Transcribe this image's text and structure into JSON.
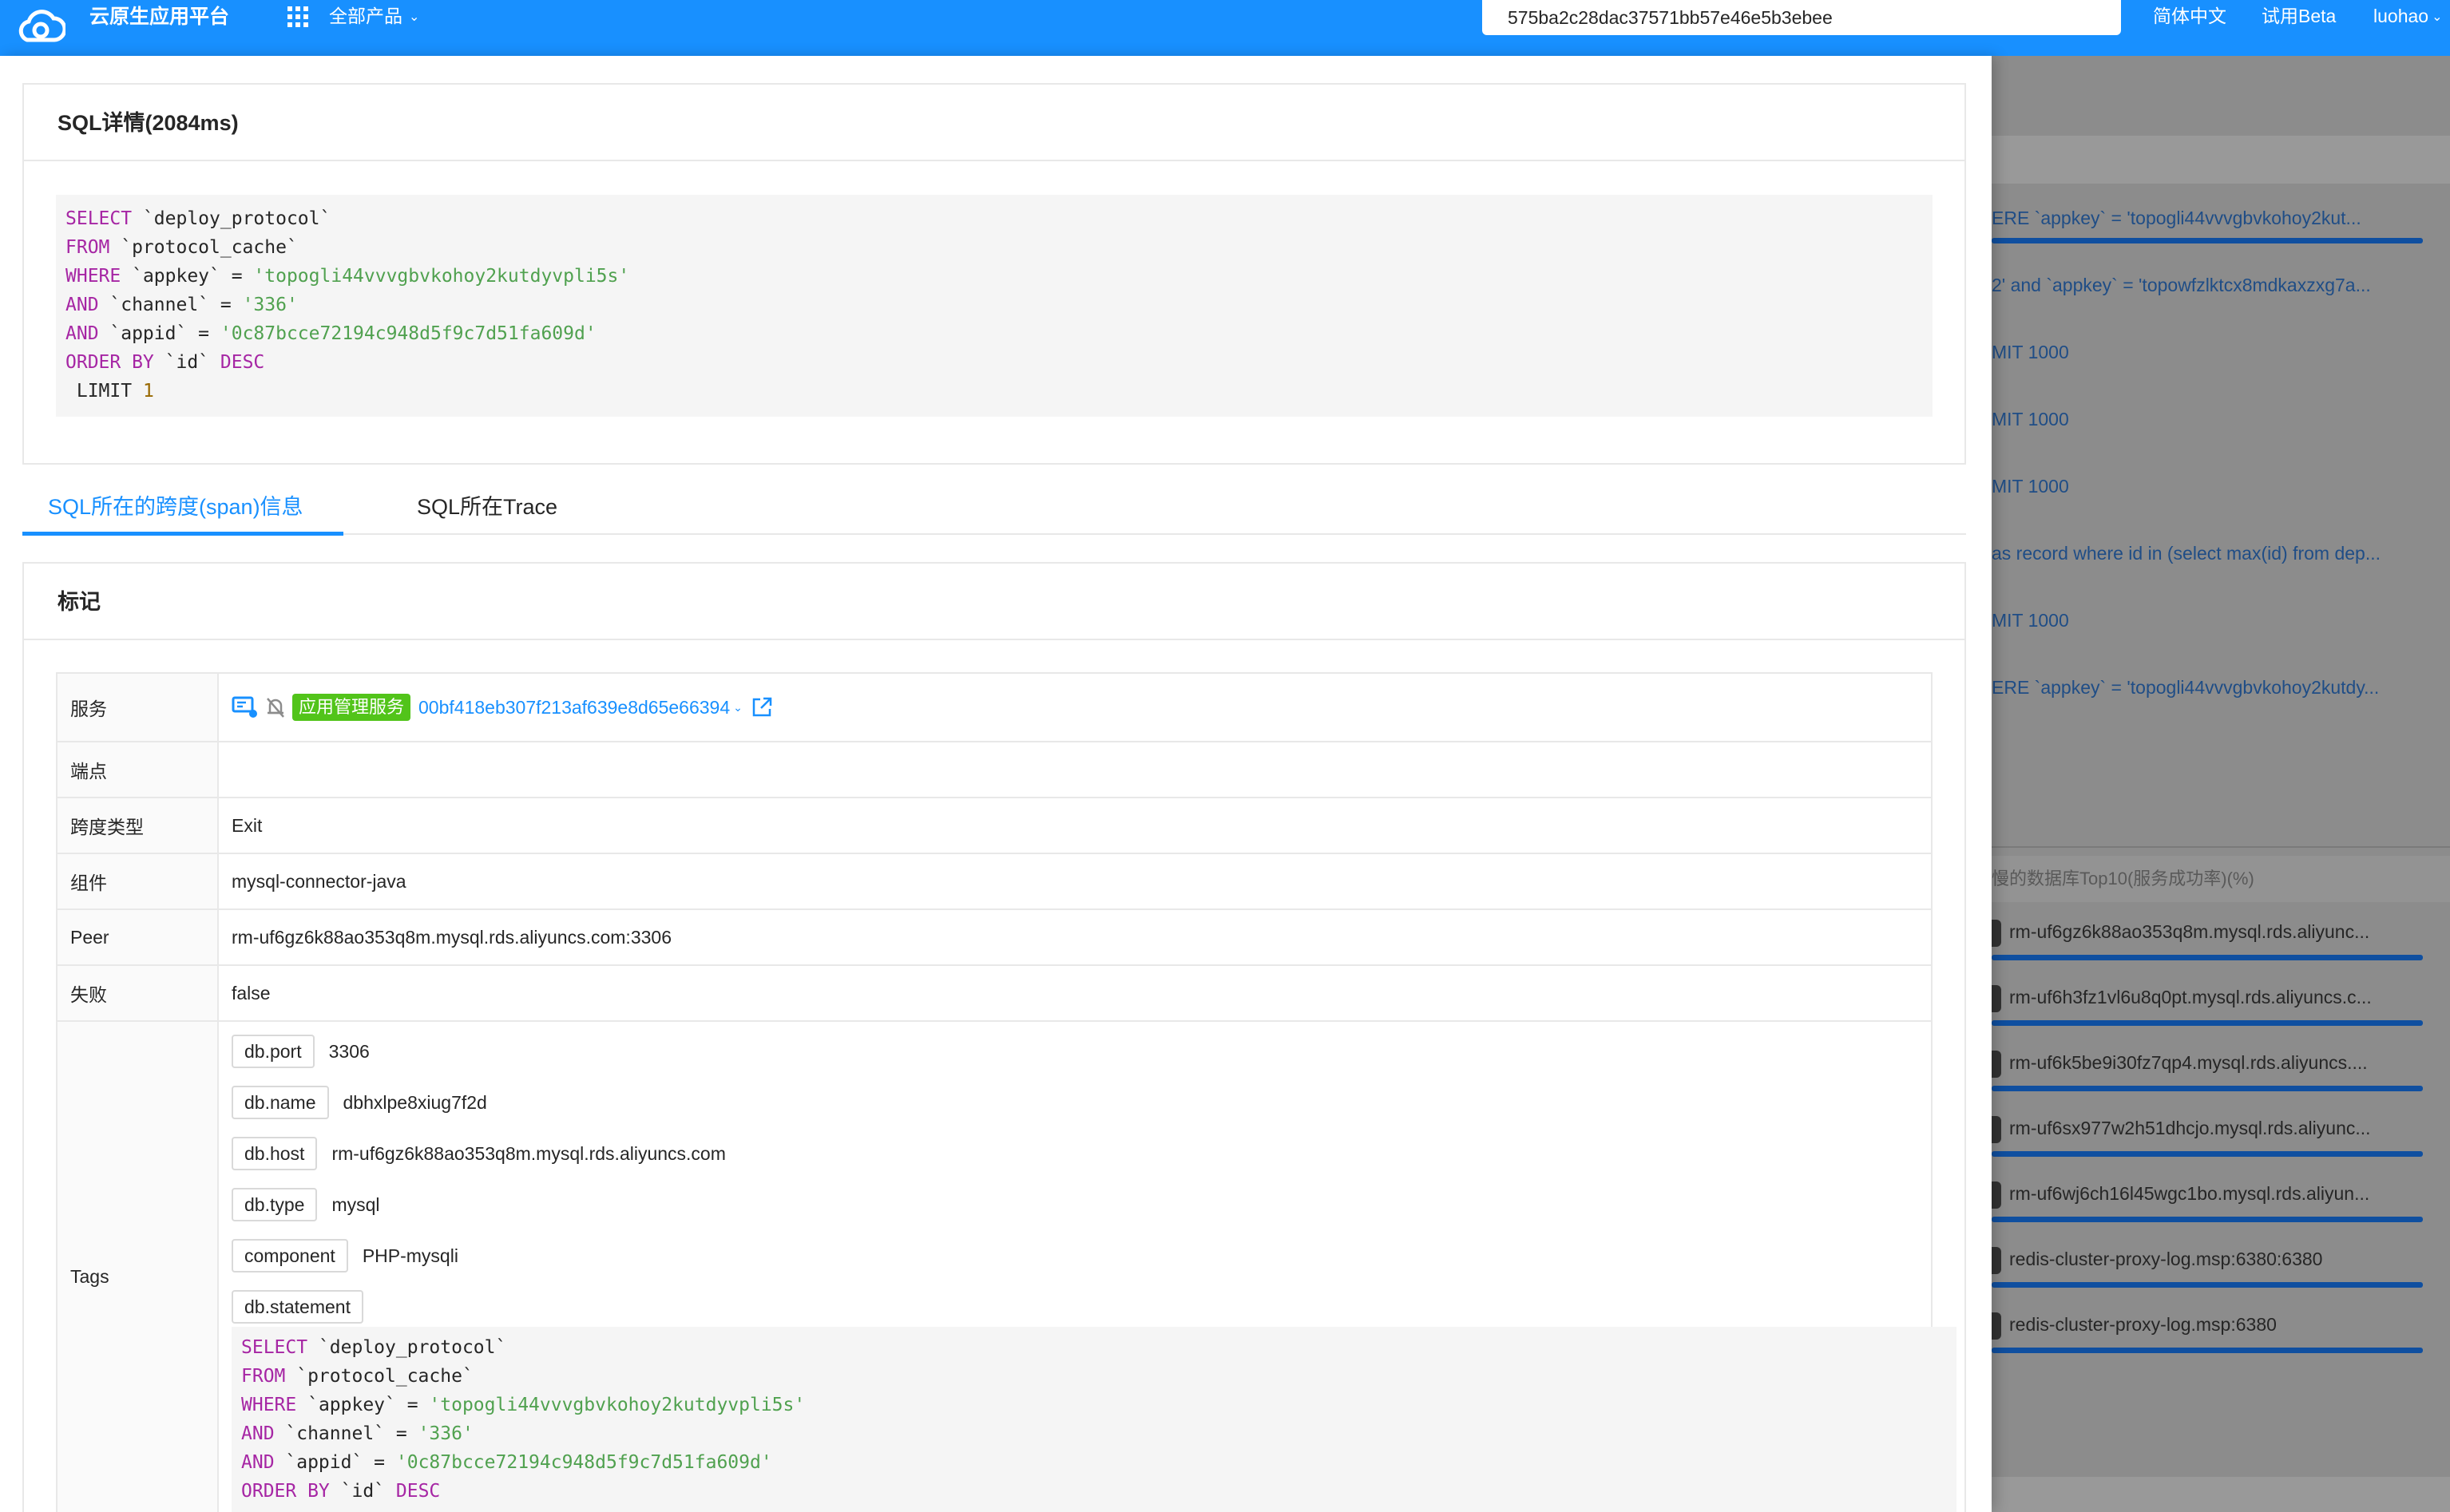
{
  "topbar": {
    "app_title": "云原生应用平台",
    "all_products": "全部产品",
    "search_value": "575ba2c28dac37571bb57e46e5b3ebee",
    "lang": "简体中文",
    "beta": "试用Beta",
    "user": "luohao"
  },
  "colors": {
    "primary": "#1890ff",
    "service_tag": "#52c41a",
    "sql_keyword": "#a626a4",
    "sql_string": "#50a14f"
  },
  "icons": [
    "cloud-logo-icon",
    "grid-icon",
    "chevron-down-icon",
    "service-monitor-icon",
    "muted-bell-icon",
    "external-link-icon"
  ],
  "sql_card": {
    "title": "SQL详情(2084ms)",
    "lines": [
      [
        {
          "t": "SELECT",
          "c": "kw"
        },
        {
          "t": " `deploy_protocol`"
        }
      ],
      [
        {
          "t": "FROM",
          "c": "kw"
        },
        {
          "t": " `protocol_cache`"
        }
      ],
      [
        {
          "t": "WHERE",
          "c": "kw"
        },
        {
          "t": " `appkey` = "
        },
        {
          "t": "'topogli44vvvgbvkohoy2kutdyvpli5s'",
          "c": "str"
        }
      ],
      [
        {
          "t": "AND",
          "c": "kw"
        },
        {
          "t": " `channel` = "
        },
        {
          "t": "'336'",
          "c": "str"
        }
      ],
      [
        {
          "t": "AND",
          "c": "kw"
        },
        {
          "t": " `appid` = "
        },
        {
          "t": "'0c87bcce72194c948d5f9c7d51fa609d'",
          "c": "str"
        }
      ],
      [
        {
          "t": "ORDER BY",
          "c": "kw"
        },
        {
          "t": " `id` "
        },
        {
          "t": "DESC",
          "c": "kw"
        }
      ],
      [
        {
          "t": " LIMIT "
        },
        {
          "t": "1",
          "c": "num"
        }
      ]
    ]
  },
  "tabs": [
    {
      "label": "SQL所在的跨度(span)信息",
      "active": true
    },
    {
      "label": "SQL所在Trace",
      "active": false
    }
  ],
  "marks_card": {
    "title": "标记",
    "rows": {
      "service": {
        "label": "服务",
        "tag": "应用管理服务",
        "id": "00bf418eb307f213af639e8d65e66394"
      },
      "endpoint": {
        "label": "端点",
        "value": ""
      },
      "span_type": {
        "label": "跨度类型",
        "value": "Exit"
      },
      "component": {
        "label": "组件",
        "value": "mysql-connector-java"
      },
      "peer": {
        "label": "Peer",
        "value": "rm-uf6gz6k88ao353q8m.mysql.rds.aliyuncs.com:3306"
      },
      "failed": {
        "label": "失败",
        "value": "false"
      },
      "tags_label": "Tags"
    },
    "tags": [
      {
        "key": "db.port",
        "value": "3306"
      },
      {
        "key": "db.name",
        "value": "dbhxlpe8xiug7f2d"
      },
      {
        "key": "db.host",
        "value": "rm-uf6gz6k88ao353q8m.mysql.rds.aliyuncs.com"
      },
      {
        "key": "db.type",
        "value": "mysql"
      },
      {
        "key": "component",
        "value": "PHP-mysqli"
      },
      {
        "key": "db.statement",
        "value": ""
      }
    ],
    "statement_lines": [
      [
        {
          "t": "SELECT",
          "c": "kw"
        },
        {
          "t": " `deploy_protocol`"
        }
      ],
      [
        {
          "t": "FROM",
          "c": "kw"
        },
        {
          "t": " `protocol_cache`"
        }
      ],
      [
        {
          "t": "WHERE",
          "c": "kw"
        },
        {
          "t": " `appkey` = "
        },
        {
          "t": "'topogli44vvvgbvkohoy2kutdyvpli5s'",
          "c": "str"
        }
      ],
      [
        {
          "t": "AND",
          "c": "kw"
        },
        {
          "t": " `channel` = "
        },
        {
          "t": "'336'",
          "c": "str"
        }
      ],
      [
        {
          "t": "AND",
          "c": "kw"
        },
        {
          "t": " `appid` = "
        },
        {
          "t": "'0c87bcce72194c948d5f9c7d51fa609d'",
          "c": "str"
        }
      ],
      [
        {
          "t": "ORDER BY",
          "c": "kw"
        },
        {
          "t": " `id` "
        },
        {
          "t": "DESC",
          "c": "kw"
        }
      ]
    ]
  },
  "background_panel": {
    "sql_links": [
      "ERE `appkey` = 'topogli44vvvgbvkohoy2kut...",
      "2' and `appkey` = 'topowfzlktcx8mdkaxzxg7a...",
      "MIT 1000",
      "MIT 1000",
      "MIT 1000",
      "as record where id in (select max(id) from dep...",
      "MIT 1000",
      "ERE `appkey` = 'topogli44vvvgbvkohoy2kutdy..."
    ],
    "db_chart_title": "慢的数据库Top10(服务成功率)(%)",
    "db_items": [
      "rm-uf6gz6k88ao353q8m.mysql.rds.aliyunc...",
      "rm-uf6h3fz1vl6u8q0pt.mysql.rds.aliyuncs.c...",
      "rm-uf6k5be9i30fz7qp4.mysql.rds.aliyuncs....",
      "rm-uf6sx977w2h51dhcjo.mysql.rds.aliyunc...",
      "rm-uf6wj6ch16l45wgc1bo.mysql.rds.aliyun...",
      "redis-cluster-proxy-log.msp:6380:6380",
      "redis-cluster-proxy-log.msp:6380"
    ]
  }
}
